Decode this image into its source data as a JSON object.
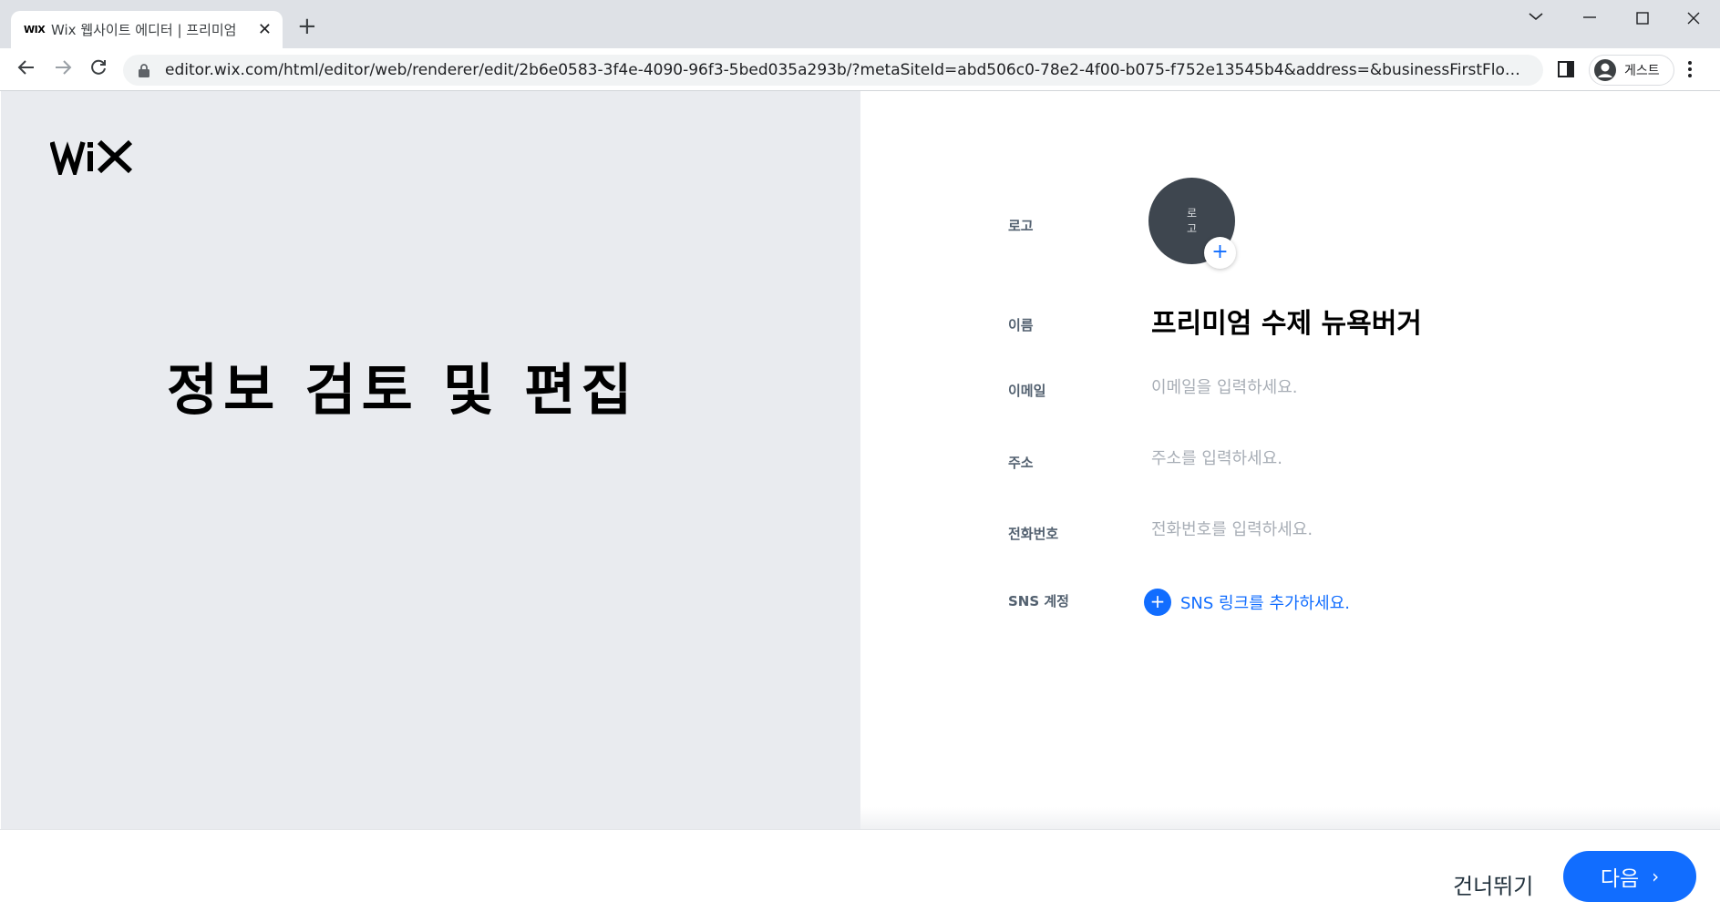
{
  "browser": {
    "tab": {
      "favicon_text": "WIX",
      "title": "Wix 웹사이트 에디터 | 프리미엄"
    },
    "url": "editor.wix.com/html/editor/web/renderer/edit/2b6e0583-3f4e-4090-96f3-5bed035a293b/?metaSiteId=abd506c0-78e2-4f00-b075-f752e13545b4&address=&businessFirstFlow=true&busin...",
    "profile_label": "게스트"
  },
  "left": {
    "logo_text": "WiX",
    "headline": "정보 검토 및 편집"
  },
  "form": {
    "logo_label": "로고",
    "logo_placeholder_line1": "로",
    "logo_placeholder_line2": "고",
    "logo_add_symbol": "+",
    "name_label": "이름",
    "name_value": "프리미엄 수제 뉴욕버거",
    "email_label": "이메일",
    "email_placeholder": "이메일을 입력하세요.",
    "address_label": "주소",
    "address_placeholder": "주소를 입력하세요.",
    "phone_label": "전화번호",
    "phone_placeholder": "전화번호를 입력하세요.",
    "sns_label": "SNS 계정",
    "sns_add_symbol": "+",
    "sns_add_text": "SNS 링크를 추가하세요."
  },
  "footer": {
    "skip_label": "건너뛰기",
    "next_label": "다음",
    "next_chevron": "›"
  },
  "colors": {
    "accent": "#116dff",
    "left_panel_bg": "#e9ebef",
    "avatar_bg": "#3e464f"
  }
}
